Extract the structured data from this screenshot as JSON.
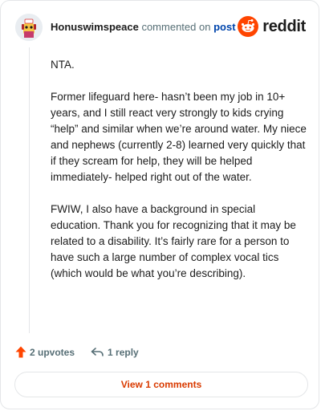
{
  "header": {
    "username": "Honuswimspeace",
    "action_text": "commented on",
    "post_link": "post",
    "avatar_icon": "snoo-avatar-icon",
    "brand_icon": "reddit-logo-icon",
    "brand_name": "reddit",
    "brand_color": "#ff4500"
  },
  "comment": {
    "paragraphs": [
      "NTA.",
      "Former lifeguard here- hasn’t been my job in 10+ years, and I still react very strongly to kids crying “help” and similar when we’re around water. My niece and nephews (currently 2-8) learned very quickly that if they scream for help, they will be helped immediately- helped right out of the water.",
      "FWIW, I also have a background in special education. Thank you for recognizing that it may be related to a disability. It’s fairly rare for a person to have such a large number of complex vocal tics (which would be what you’re describing)."
    ]
  },
  "actions": {
    "upvote_icon": "upvote-arrow-icon",
    "upvote_label": "2 upvotes",
    "upvote_color": "#ff4500",
    "reply_icon": "reply-arrow-icon",
    "reply_label": "1 reply"
  },
  "footer": {
    "view_comments_label": "View 1 comments",
    "accent_color": "#d93a00"
  }
}
